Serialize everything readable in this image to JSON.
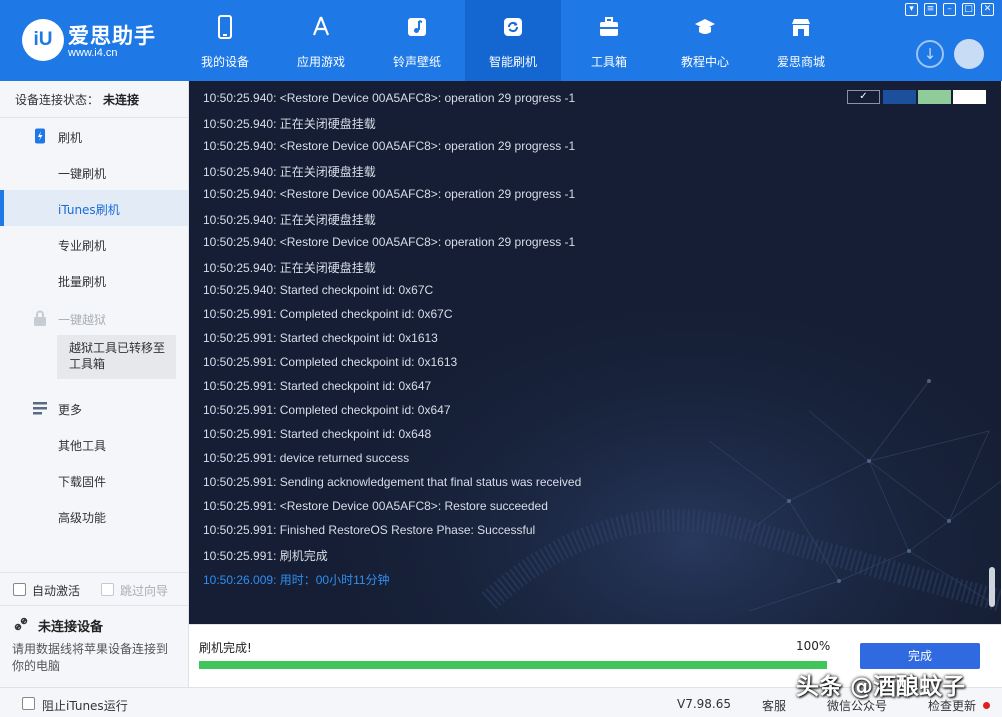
{
  "brand": {
    "title": "爱思助手",
    "url": "www.i4.cn",
    "logo_text": "iU"
  },
  "nav": [
    {
      "label": "我的设备",
      "icon": "phone-icon"
    },
    {
      "label": "应用游戏",
      "icon": "app-store-icon"
    },
    {
      "label": "铃声壁纸",
      "icon": "music-icon"
    },
    {
      "label": "智能刷机",
      "icon": "refresh-icon",
      "active": true
    },
    {
      "label": "工具箱",
      "icon": "toolbox-icon"
    },
    {
      "label": "教程中心",
      "icon": "graduation-cap-icon"
    },
    {
      "label": "爱思商城",
      "icon": "store-icon"
    }
  ],
  "sidebar": {
    "status_label": "设备连接状态：",
    "status_value": "未连接",
    "flash_group": "刷机",
    "items": [
      "一键刷机",
      "iTunes刷机",
      "专业刷机",
      "批量刷机"
    ],
    "active_item": "iTunes刷机",
    "jailbreak_group": "一键越狱",
    "jailbreak_note": "越狱工具已转移至工具箱",
    "more_group": "更多",
    "more_items": [
      "其他工具",
      "下载固件",
      "高级功能"
    ],
    "auto_activate": "自动激活",
    "skip_guide": "跳过向导",
    "device_title": "未连接设备",
    "device_desc": "请用数据线将苹果设备连接到你的电脑"
  },
  "log_lines": [
    "10:50:25.940: <Restore Device 00A5AFC8>: operation 29 progress -1",
    "10:50:25.940:  正在关闭硬盘挂载",
    "10:50:25.940: <Restore Device 00A5AFC8>: operation 29 progress -1",
    "10:50:25.940:  正在关闭硬盘挂载",
    "10:50:25.940: <Restore Device 00A5AFC8>: operation 29 progress -1",
    "10:50:25.940:  正在关闭硬盘挂载",
    "10:50:25.940: <Restore Device 00A5AFC8>: operation 29 progress -1",
    "10:50:25.940:  正在关闭硬盘挂载",
    "10:50:25.940: Started checkpoint id: 0x67C",
    "10:50:25.991: Completed checkpoint id: 0x67C",
    "10:50:25.991: Started checkpoint id: 0x1613",
    "10:50:25.991: Completed checkpoint id: 0x1613",
    "10:50:25.991: Started checkpoint id: 0x647",
    "10:50:25.991: Completed checkpoint id: 0x647",
    "10:50:25.991: Started checkpoint id: 0x648",
    "10:50:25.991: device returned success",
    "10:50:25.991: Sending acknowledgement that final status was received",
    "10:50:25.991: <Restore Device 00A5AFC8>: Restore succeeded",
    "10:50:25.991: Finished RestoreOS Restore Phase: Successful",
    "10:50:25.991:  刷机完成",
    "10:50:26.009:  用时：00小时11分钟"
  ],
  "theme_swatches": [
    "#151e34",
    "#1c4f9c",
    "#8fcc9a",
    "#ffffff"
  ],
  "progress": {
    "label": "刷机完成!",
    "percent_text": "100%",
    "value": 1.0,
    "button": "完成"
  },
  "statusbar": {
    "block_itunes": "阻止iTunes运行",
    "version": "V7.98.65",
    "service": "客服",
    "wechat": "微信公众号",
    "update": "检查更新"
  },
  "watermark": "头条 @酒酿蚊子",
  "colors": {
    "accent": "#1e78e6",
    "progress": "#3fc559",
    "highlight_log": "#2f8ff0",
    "log_bg": "#151e34"
  }
}
